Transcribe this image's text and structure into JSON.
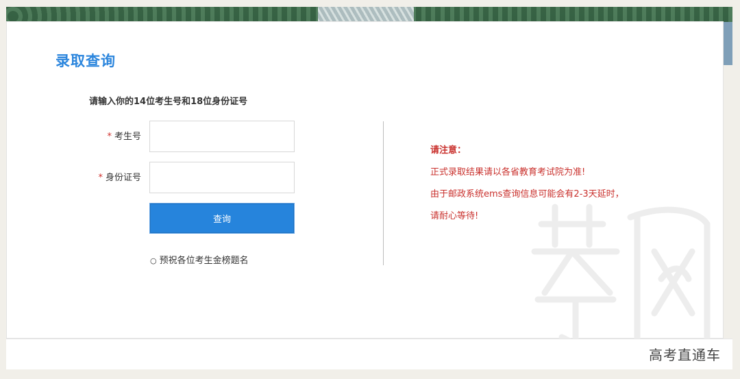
{
  "page": {
    "title": "录取查询",
    "instruction": "请输入你的14位考生号和18位身份证号"
  },
  "form": {
    "required_mark": "*",
    "exam_number_label": "考生号",
    "exam_number_value": "",
    "id_number_label": "身份证号",
    "id_number_value": "",
    "submit_label": "查询",
    "wish_bullet": "○",
    "wish_text": "预祝各位考生金榜题名"
  },
  "notice": {
    "title": "请注意：",
    "lines": [
      "正式录取结果请以各省教育考试院为准!",
      "由于邮政系统ems查询信息可能会有2-3天延时，",
      "请耐心等待!"
    ]
  },
  "footer": {
    "brand": "高考直通车"
  },
  "colors": {
    "accent": "#2684dc",
    "notice": "#c9302c",
    "title": "#2c86dd"
  }
}
